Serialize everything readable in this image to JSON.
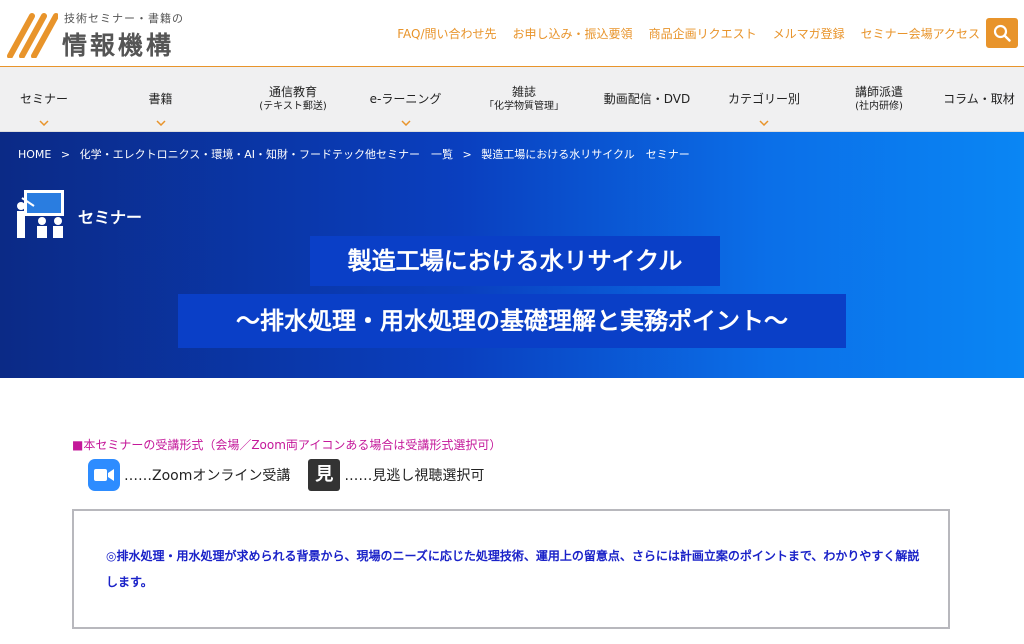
{
  "logo": {
    "subtitle": "技術セミナー・書籍の",
    "name": "情報機構"
  },
  "toplinks": [
    "FAQ/問い合わせ先",
    "お申し込み・振込要領",
    "商品企画リクエスト",
    "メルマガ登録",
    "セミナー会場アクセス"
  ],
  "nav": [
    {
      "label": "セミナー",
      "sub": "",
      "chevron": true
    },
    {
      "label": "書籍",
      "sub": "",
      "chevron": true
    },
    {
      "label": "通信教育",
      "sub": "(テキスト郵送)",
      "chevron": false
    },
    {
      "label": "e-ラーニング",
      "sub": "",
      "chevron": true
    },
    {
      "label": "雑誌",
      "sub": "「化学物質管理」",
      "chevron": false
    },
    {
      "label": "動画配信・DVD",
      "sub": "",
      "chevron": false
    },
    {
      "label": "カテゴリー別",
      "sub": "",
      "chevron": true
    },
    {
      "label": "講師派遣",
      "sub": "(社内研修)",
      "chevron": false
    },
    {
      "label": "コラム・取材",
      "sub": "",
      "chevron": false
    }
  ],
  "breadcrumb": [
    "HOME",
    ">",
    "化学・エレクトロニクス・環境・AI・知財・フードテック他セミナー　一覧",
    ">",
    "製造工場における水リサイクル　セミナー"
  ],
  "hero": {
    "label": "セミナー",
    "title_line1": "製造工場における水リサイクル",
    "title_line2": "〜排水処理・用水処理の基礎理解と実務ポイント〜"
  },
  "format": {
    "heading": "■本セミナーの受講形式（会場／Zoom両アイコンある場合は受講形式選択可）",
    "zoom_text": "……Zoomオンライン受講",
    "mi_icon_text": "見",
    "mi_text": "……見逃し視聴選択可"
  },
  "description": "◎排水処理・用水処理が求められる背景から、現場のニーズに応じた処理技術、運用上の留意点、さらには計画立案のポイントまで、わかりやすく解説します。",
  "colors": {
    "accent": "#e8942b",
    "hero": "#0a3fc7",
    "highlight": "#c4189a",
    "desc_text": "#1a22c8"
  }
}
